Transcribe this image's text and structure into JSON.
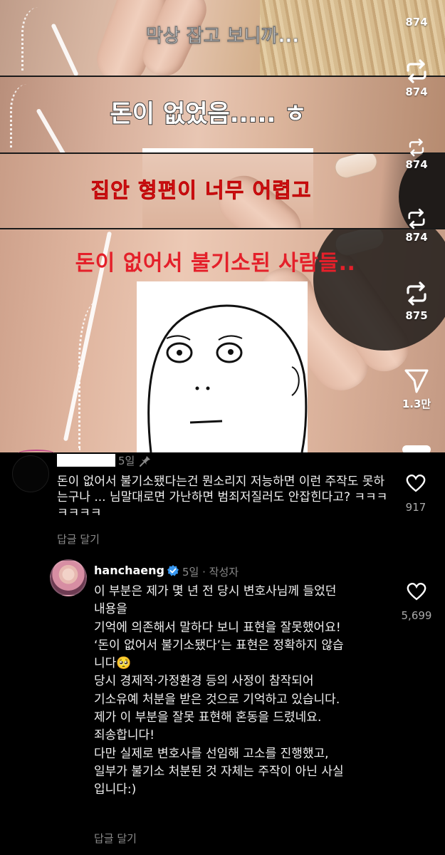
{
  "video": {
    "captions": [
      "막상 잡고 보니까...",
      "돈이 없었음..... ㅎ",
      "집안 형편이 너무 어렵고",
      "돈이 없어서 불기소된 사람들.."
    ]
  },
  "actions": {
    "counts": [
      "874",
      "874",
      "874",
      "874",
      "875"
    ],
    "share_count": "1.3만"
  },
  "comments": [
    {
      "time": "5일",
      "text": "돈이 없어서 불기소됐다는건 뭔소리지 저능하면 이런 주작도 못하는구나 ... 님말대로면 가난하면 범죄저질러도 안잡힌다고? ㅋㅋㅋㅋㅋㅋㅋ",
      "reply_label": "답글 달기",
      "likes": "917"
    },
    {
      "username": "hanchaeng",
      "meta": "5일 · 작성자",
      "lines": [
        "이 부분은 제가 몇 년 전 당시 변호사님께 들었던",
        "내용을",
        "기억에 의존해서 말하다 보니 표현을 잘못했어요!",
        "‘돈이 없어서 불기소됐다’는 표현은 정확하지 않습",
        "니다🥺",
        "당시 경제적·가정환경 등의 사정이 참작되어",
        "기소유예 처분을 받은 것으로 기억하고 있습니다.",
        "제가 이 부분을 잘못 표현해 혼동을 드렸네요.",
        "죄송합니다!",
        "다만 실제로 변호사를 선임해 고소를 진행했고,",
        "일부가 불기소 처분된 것 자체는 주작이 아닌 사실",
        "입니다:)"
      ],
      "reply_label": "답글 달기",
      "likes": "5,699"
    }
  ],
  "colors": {
    "caption_red": "#e4202a",
    "muted_text": "#8a8a8a",
    "verified_blue": "#3897f0"
  }
}
